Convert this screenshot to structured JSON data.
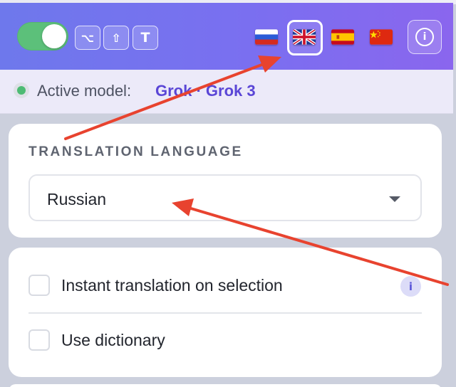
{
  "header": {
    "toggle": {
      "state": "on",
      "color": "#5cc07a"
    },
    "shortcut_keys": [
      {
        "label": "⌥",
        "icon": "option-key-icon"
      },
      {
        "label": "⇧",
        "icon": "shift-key-icon"
      },
      {
        "label": "T",
        "icon": "t-key-icon"
      }
    ],
    "flags": [
      {
        "icon": "russia-flag-icon",
        "selected": false
      },
      {
        "icon": "uk-flag-icon",
        "selected": true
      },
      {
        "icon": "spain-flag-icon",
        "selected": false
      },
      {
        "icon": "china-flag-icon",
        "selected": false
      }
    ],
    "info_icon_glyph": "i",
    "gradient": [
      "#6e78ec",
      "#8a66ee"
    ]
  },
  "status": {
    "label": "Active model:",
    "model": "Grok · Grok 3",
    "indicator_color": "#4dbb74",
    "model_color": "#5a46d6"
  },
  "translation": {
    "section_title": "TRANSLATION LANGUAGE",
    "selected_language": "Russian"
  },
  "options": {
    "instant_translation": {
      "label": "Instant translation on selection",
      "checked": false
    },
    "use_dictionary": {
      "label": "Use dictionary",
      "checked": false
    },
    "info_glyph": "i"
  },
  "annotations": {
    "arrow_color": "#e8432f"
  }
}
